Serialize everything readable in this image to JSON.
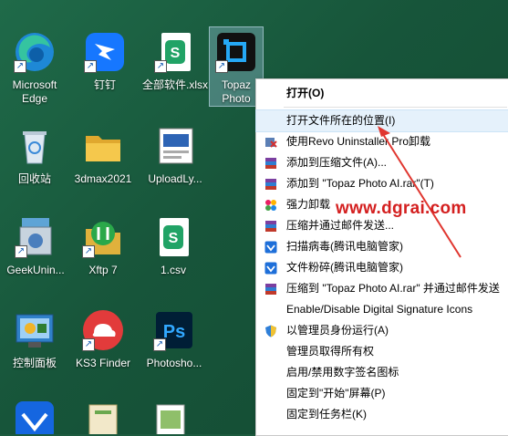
{
  "desktop": {
    "icons": [
      {
        "label": "Microsoft\nEdge",
        "icon": "edge-icon"
      },
      {
        "label": "钉钉",
        "icon": "dingtalk-icon"
      },
      {
        "label": "全部软件.xlsx",
        "icon": "excel-file-icon"
      },
      {
        "label": "Topaz\nPhoto",
        "icon": "topaz-photo-icon"
      },
      {
        "label": "回收站",
        "icon": "recycle-bin-icon"
      },
      {
        "label": "3dmax2021",
        "icon": "folder-icon"
      },
      {
        "label": "UploadLy...",
        "icon": "document-icon"
      },
      {
        "label": "GeekUnin...",
        "icon": "geek-uninstaller-icon"
      },
      {
        "label": "Xftp 7",
        "icon": "xftp-icon"
      },
      {
        "label": "1.csv",
        "icon": "csv-file-icon"
      },
      {
        "label": "控制面板",
        "icon": "control-panel-icon"
      },
      {
        "label": "KS3 Finder",
        "icon": "ks3-finder-icon"
      },
      {
        "label": "Photosho...",
        "icon": "photoshop-icon"
      }
    ]
  },
  "context_menu": {
    "items": [
      {
        "label": "打开(O)",
        "bold": true,
        "icon": ""
      },
      {
        "label": "打开文件所在的位置(I)",
        "icon": ""
      },
      {
        "label": "使用Revo Uninstaller Pro卸载",
        "icon": "revo-uninstaller-icon"
      },
      {
        "label": "添加到压缩文件(A)...",
        "icon": "winrar-icon"
      },
      {
        "label": "添加到 \"Topaz Photo AI.rar\"(T)",
        "icon": "winrar-icon"
      },
      {
        "label": "强力卸载",
        "icon": "uninstall-icon"
      },
      {
        "label": "压缩并通过邮件发送...",
        "icon": "winrar-icon"
      },
      {
        "label": "扫描病毒(腾讯电脑管家)",
        "icon": "tencent-shield-icon"
      },
      {
        "label": "文件粉碎(腾讯电脑管家)",
        "icon": "tencent-shield-icon"
      },
      {
        "label": "压缩到 \"Topaz Photo AI.rar\" 并通过邮件发送",
        "icon": "winrar-icon"
      },
      {
        "label": "Enable/Disable Digital Signature Icons",
        "icon": ""
      },
      {
        "label": "以管理员身份运行(A)",
        "icon": "uac-shield-icon"
      },
      {
        "label": "管理员取得所有权",
        "icon": ""
      },
      {
        "label": "启用/禁用数字签名图标",
        "icon": ""
      },
      {
        "label": "固定到\"开始\"屏幕(P)",
        "icon": ""
      },
      {
        "label": "固定到任务栏(K)",
        "icon": ""
      }
    ]
  },
  "watermark": "www.dgrai.com",
  "colors": {
    "desktop": "#1c5a3e",
    "watermark": "#d42020",
    "highlight": "#e5f1fb"
  }
}
